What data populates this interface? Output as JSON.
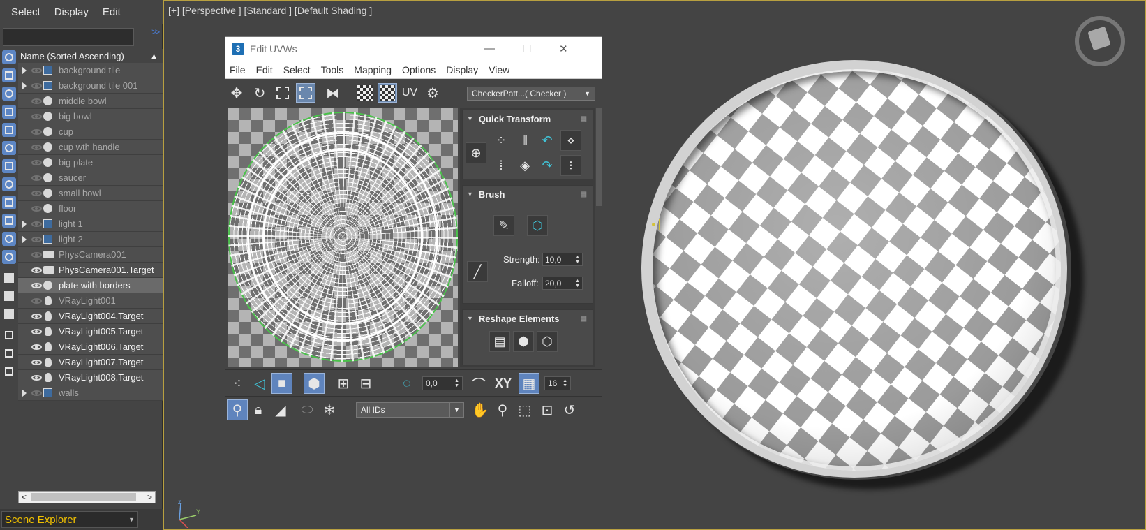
{
  "explorer": {
    "menu": [
      "Select",
      "Display",
      "Edit"
    ],
    "column_header": "Name (Sorted Ascending)",
    "footer_label": "Scene Explorer",
    "rows": [
      {
        "label": "background tile",
        "icon": "group-icon",
        "expandable": true,
        "eye": "hidden",
        "style": "dim"
      },
      {
        "label": "background tile 001",
        "icon": "group-icon",
        "expandable": true,
        "eye": "hidden",
        "style": "dim"
      },
      {
        "label": "middle bowl",
        "icon": "sphere-icon",
        "expandable": false,
        "eye": "hidden",
        "style": "dim"
      },
      {
        "label": "big bowl",
        "icon": "sphere-icon",
        "expandable": false,
        "eye": "hidden",
        "style": "dim"
      },
      {
        "label": "cup",
        "icon": "sphere-icon",
        "expandable": false,
        "eye": "hidden",
        "style": "dim"
      },
      {
        "label": "cup wth handle",
        "icon": "sphere-icon",
        "expandable": false,
        "eye": "hidden",
        "style": "dim"
      },
      {
        "label": "big plate",
        "icon": "sphere-icon",
        "expandable": false,
        "eye": "hidden",
        "style": "dim"
      },
      {
        "label": "saucer",
        "icon": "sphere-icon",
        "expandable": false,
        "eye": "hidden",
        "style": "dim"
      },
      {
        "label": "small bowl",
        "icon": "sphere-icon",
        "expandable": false,
        "eye": "hidden",
        "style": "dim"
      },
      {
        "label": "floor",
        "icon": "sphere-icon",
        "expandable": false,
        "eye": "hidden",
        "style": "dim"
      },
      {
        "label": "light 1",
        "icon": "group-icon",
        "expandable": true,
        "eye": "hidden",
        "style": "dim"
      },
      {
        "label": "light 2",
        "icon": "group-icon",
        "expandable": true,
        "eye": "hidden",
        "style": "dim"
      },
      {
        "label": "PhysCamera001",
        "icon": "camera-icon",
        "expandable": false,
        "eye": "hidden",
        "style": "dim"
      },
      {
        "label": "PhysCamera001.Target",
        "icon": "camera-icon",
        "expandable": false,
        "eye": "visible",
        "style": "bright"
      },
      {
        "label": "plate with borders",
        "icon": "sphere-icon",
        "expandable": false,
        "eye": "visible",
        "style": "bright",
        "selected": true
      },
      {
        "label": "VRayLight001",
        "icon": "bulb-icon",
        "expandable": false,
        "eye": "hidden",
        "style": "dim"
      },
      {
        "label": "VRayLight004.Target",
        "icon": "bulb-icon",
        "expandable": false,
        "eye": "visible",
        "style": "bright"
      },
      {
        "label": "VRayLight005.Target",
        "icon": "bulb-icon",
        "expandable": false,
        "eye": "visible",
        "style": "bright"
      },
      {
        "label": "VRayLight006.Target",
        "icon": "bulb-icon",
        "expandable": false,
        "eye": "visible",
        "style": "bright"
      },
      {
        "label": "VRayLight007.Target",
        "icon": "bulb-icon",
        "expandable": false,
        "eye": "visible",
        "style": "bright"
      },
      {
        "label": "VRayLight008.Target",
        "icon": "bulb-icon",
        "expandable": false,
        "eye": "visible",
        "style": "bright"
      },
      {
        "label": "walls",
        "icon": "group-icon",
        "expandable": true,
        "eye": "hidden",
        "style": "dim"
      }
    ]
  },
  "viewport": {
    "label": "[+] [Perspective ] [Standard ] [Default Shading ]",
    "axis_labels": {
      "x": "X",
      "y": "Y",
      "z": "Z"
    }
  },
  "uvw": {
    "title": "Edit UVWs",
    "menu": [
      "File",
      "Edit",
      "Select",
      "Tools",
      "Mapping",
      "Options",
      "Display",
      "View"
    ],
    "uv_label": "UV",
    "texture_dropdown": "CheckerPatt...( Checker )",
    "panels": {
      "quick_transform": "Quick Transform",
      "brush": "Brush",
      "strength_label": "Strength:",
      "strength_value": "10,0",
      "falloff_label": "Falloff:",
      "falloff_value": "20,0",
      "reshape": "Reshape Elements"
    },
    "bottom": {
      "soft_value": "0,0",
      "xy_label": "XY",
      "snap_value": "16",
      "ids_dropdown": "All IDs"
    }
  },
  "colors": {
    "accent_blue": "#5d86c4",
    "footer_text": "#f0c000",
    "uv_seam_green": "#49c24a",
    "viewport_border": "#b8a040"
  }
}
